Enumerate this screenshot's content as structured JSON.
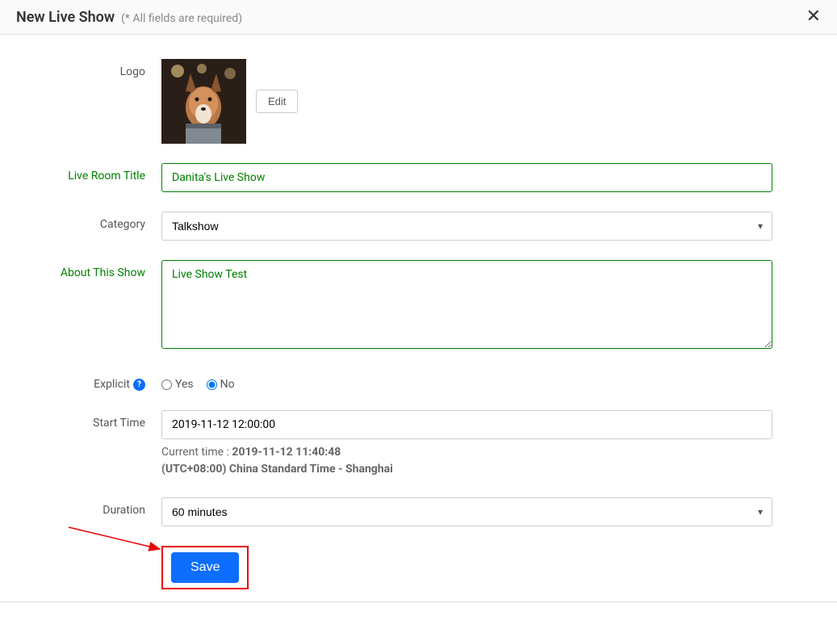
{
  "header": {
    "title": "New Live Show",
    "subtitle": "(* All fields are required)"
  },
  "form": {
    "logo_label": "Logo",
    "edit_button": "Edit",
    "title_label": "Live Room Title",
    "title_value": "Danita's Live Show",
    "category_label": "Category",
    "category_value": "Talkshow",
    "about_label": "About This Show",
    "about_value": "Live Show Test",
    "explicit_label": "Explicit",
    "explicit_yes": "Yes",
    "explicit_no": "No",
    "start_time_label": "Start Time",
    "start_time_value": "2019-11-12 12:00:00",
    "current_time_prefix": "Current time : ",
    "current_time_value": "2019-11-12 11:40:48",
    "timezone": "(UTC+08:00) China Standard Time - Shanghai",
    "duration_label": "Duration",
    "duration_value": "60 minutes",
    "save_button": "Save"
  }
}
